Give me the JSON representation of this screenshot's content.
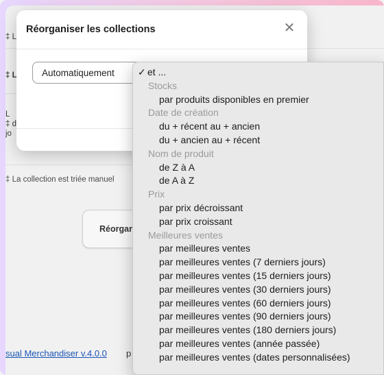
{
  "background": {
    "rows": [
      {
        "text": "‡ L"
      },
      {
        "text": "‡ L"
      },
      {
        "text": "L\n‡ d\njo"
      },
      {
        "text": "‡ La collection est triée manuel"
      }
    ],
    "button_label": "Réorgan",
    "footer_link": "sual Merchandiser v.4.0.0",
    "footer_tail": "p"
  },
  "modal": {
    "title": "Réorganiser les collections",
    "close_glyph": "✕",
    "select_value": "Automatiquement",
    "select_arrow": "⌃⌄"
  },
  "menu": {
    "checkmark": "✓",
    "first_item": "et ...",
    "groups": [
      {
        "label": "Stocks",
        "options": [
          "par produits disponibles en premier"
        ]
      },
      {
        "label": "Date de création",
        "options": [
          "du + récent au + ancien",
          "du + ancien au + récent"
        ]
      },
      {
        "label": "Nom de produit",
        "options": [
          "de Z à A",
          "de A à Z"
        ]
      },
      {
        "label": "Prix",
        "options": [
          "par prix décroissant",
          "par prix croissant"
        ]
      },
      {
        "label": "Meilleures ventes",
        "options": [
          "par meilleures ventes",
          "par meilleures ventes (7 derniers jours)",
          "par meilleures ventes (15 derniers jours)",
          "par meilleures ventes (30 derniers jours)",
          "par meilleures ventes (60 derniers jours)",
          "par meilleures ventes (90 derniers jours)",
          "par meilleures ventes (180 derniers jours)",
          "par meilleures ventes (année passée)",
          "par meilleures ventes (dates personnalisées)"
        ]
      }
    ]
  }
}
